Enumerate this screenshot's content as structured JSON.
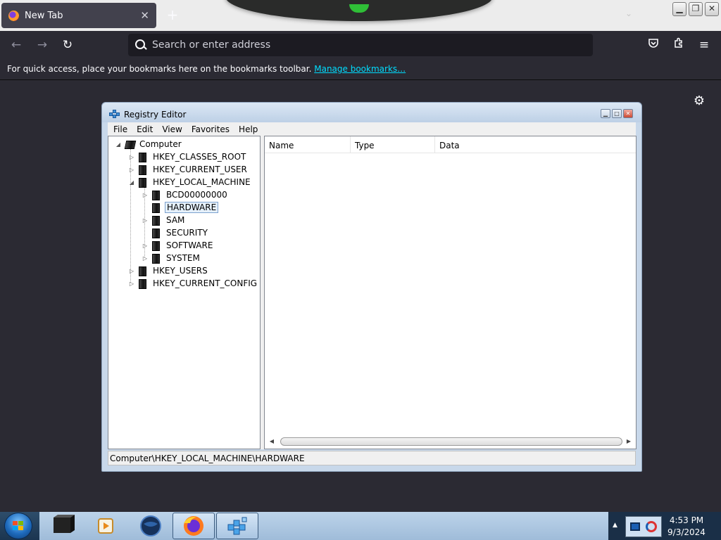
{
  "browser": {
    "tab": {
      "title": "New Tab",
      "close_glyph": "✕"
    },
    "new_tab_glyph": "+",
    "overflow_glyph": "⌄",
    "address_placeholder": "Search or enter address",
    "bookmarks_bar": {
      "message": "For quick access, place your bookmarks here on the bookmarks toolbar.",
      "link": "Manage bookmarks…"
    },
    "icons": {
      "back": "back-arrow-icon",
      "forward": "forward-arrow-icon",
      "reload": "reload-icon",
      "pocket": "pocket-icon",
      "extensions": "extensions-icon",
      "menu": "hamburger-menu-icon",
      "settings": "gear-icon"
    }
  },
  "regedit": {
    "title": "Registry Editor",
    "menu": [
      "File",
      "Edit",
      "View",
      "Favorites",
      "Help"
    ],
    "tree": {
      "root": "Computer",
      "hives": [
        "HKEY_CLASSES_ROOT",
        "HKEY_CURRENT_USER",
        "HKEY_LOCAL_MACHINE",
        "HKEY_USERS",
        "HKEY_CURRENT_CONFIG"
      ],
      "local_machine_children": [
        "BCD00000000",
        "HARDWARE",
        "SAM",
        "SECURITY",
        "SOFTWARE",
        "SYSTEM"
      ],
      "selected": "HARDWARE"
    },
    "columns": [
      "Name",
      "Type",
      "Data"
    ],
    "status": "Computer\\HKEY_LOCAL_MACHINE\\HARDWARE"
  },
  "taskbar": {
    "time": "4:53 PM",
    "date": "9/3/2024"
  },
  "colors": {
    "browser_bg": "#2b2a33",
    "link": "#00ddff",
    "taskbar": "#9fbcd9"
  }
}
